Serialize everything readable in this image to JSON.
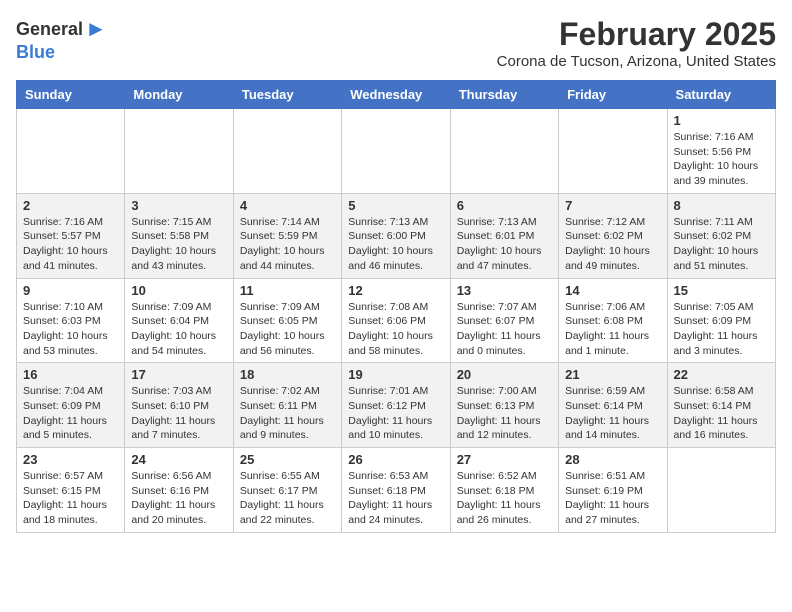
{
  "header": {
    "logo_general": "General",
    "logo_blue": "Blue",
    "title": "February 2025",
    "subtitle": "Corona de Tucson, Arizona, United States"
  },
  "weekdays": [
    "Sunday",
    "Monday",
    "Tuesday",
    "Wednesday",
    "Thursday",
    "Friday",
    "Saturday"
  ],
  "weeks": [
    [
      {
        "day": "",
        "info": ""
      },
      {
        "day": "",
        "info": ""
      },
      {
        "day": "",
        "info": ""
      },
      {
        "day": "",
        "info": ""
      },
      {
        "day": "",
        "info": ""
      },
      {
        "day": "",
        "info": ""
      },
      {
        "day": "1",
        "info": "Sunrise: 7:16 AM\nSunset: 5:56 PM\nDaylight: 10 hours\nand 39 minutes."
      }
    ],
    [
      {
        "day": "2",
        "info": "Sunrise: 7:16 AM\nSunset: 5:57 PM\nDaylight: 10 hours\nand 41 minutes."
      },
      {
        "day": "3",
        "info": "Sunrise: 7:15 AM\nSunset: 5:58 PM\nDaylight: 10 hours\nand 43 minutes."
      },
      {
        "day": "4",
        "info": "Sunrise: 7:14 AM\nSunset: 5:59 PM\nDaylight: 10 hours\nand 44 minutes."
      },
      {
        "day": "5",
        "info": "Sunrise: 7:13 AM\nSunset: 6:00 PM\nDaylight: 10 hours\nand 46 minutes."
      },
      {
        "day": "6",
        "info": "Sunrise: 7:13 AM\nSunset: 6:01 PM\nDaylight: 10 hours\nand 47 minutes."
      },
      {
        "day": "7",
        "info": "Sunrise: 7:12 AM\nSunset: 6:02 PM\nDaylight: 10 hours\nand 49 minutes."
      },
      {
        "day": "8",
        "info": "Sunrise: 7:11 AM\nSunset: 6:02 PM\nDaylight: 10 hours\nand 51 minutes."
      }
    ],
    [
      {
        "day": "9",
        "info": "Sunrise: 7:10 AM\nSunset: 6:03 PM\nDaylight: 10 hours\nand 53 minutes."
      },
      {
        "day": "10",
        "info": "Sunrise: 7:09 AM\nSunset: 6:04 PM\nDaylight: 10 hours\nand 54 minutes."
      },
      {
        "day": "11",
        "info": "Sunrise: 7:09 AM\nSunset: 6:05 PM\nDaylight: 10 hours\nand 56 minutes."
      },
      {
        "day": "12",
        "info": "Sunrise: 7:08 AM\nSunset: 6:06 PM\nDaylight: 10 hours\nand 58 minutes."
      },
      {
        "day": "13",
        "info": "Sunrise: 7:07 AM\nSunset: 6:07 PM\nDaylight: 11 hours\nand 0 minutes."
      },
      {
        "day": "14",
        "info": "Sunrise: 7:06 AM\nSunset: 6:08 PM\nDaylight: 11 hours\nand 1 minute."
      },
      {
        "day": "15",
        "info": "Sunrise: 7:05 AM\nSunset: 6:09 PM\nDaylight: 11 hours\nand 3 minutes."
      }
    ],
    [
      {
        "day": "16",
        "info": "Sunrise: 7:04 AM\nSunset: 6:09 PM\nDaylight: 11 hours\nand 5 minutes."
      },
      {
        "day": "17",
        "info": "Sunrise: 7:03 AM\nSunset: 6:10 PM\nDaylight: 11 hours\nand 7 minutes."
      },
      {
        "day": "18",
        "info": "Sunrise: 7:02 AM\nSunset: 6:11 PM\nDaylight: 11 hours\nand 9 minutes."
      },
      {
        "day": "19",
        "info": "Sunrise: 7:01 AM\nSunset: 6:12 PM\nDaylight: 11 hours\nand 10 minutes."
      },
      {
        "day": "20",
        "info": "Sunrise: 7:00 AM\nSunset: 6:13 PM\nDaylight: 11 hours\nand 12 minutes."
      },
      {
        "day": "21",
        "info": "Sunrise: 6:59 AM\nSunset: 6:14 PM\nDaylight: 11 hours\nand 14 minutes."
      },
      {
        "day": "22",
        "info": "Sunrise: 6:58 AM\nSunset: 6:14 PM\nDaylight: 11 hours\nand 16 minutes."
      }
    ],
    [
      {
        "day": "23",
        "info": "Sunrise: 6:57 AM\nSunset: 6:15 PM\nDaylight: 11 hours\nand 18 minutes."
      },
      {
        "day": "24",
        "info": "Sunrise: 6:56 AM\nSunset: 6:16 PM\nDaylight: 11 hours\nand 20 minutes."
      },
      {
        "day": "25",
        "info": "Sunrise: 6:55 AM\nSunset: 6:17 PM\nDaylight: 11 hours\nand 22 minutes."
      },
      {
        "day": "26",
        "info": "Sunrise: 6:53 AM\nSunset: 6:18 PM\nDaylight: 11 hours\nand 24 minutes."
      },
      {
        "day": "27",
        "info": "Sunrise: 6:52 AM\nSunset: 6:18 PM\nDaylight: 11 hours\nand 26 minutes."
      },
      {
        "day": "28",
        "info": "Sunrise: 6:51 AM\nSunset: 6:19 PM\nDaylight: 11 hours\nand 27 minutes."
      },
      {
        "day": "",
        "info": ""
      }
    ]
  ]
}
